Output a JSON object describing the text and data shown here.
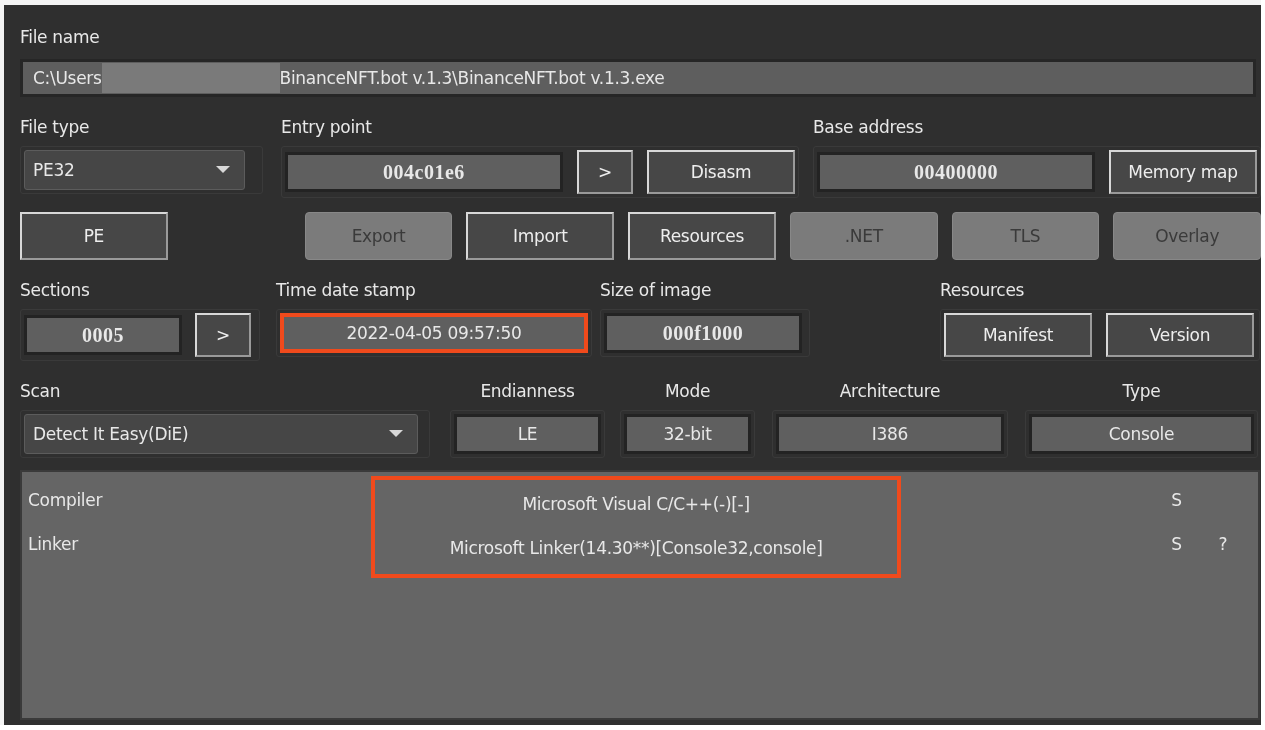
{
  "file_name": {
    "label": "File name",
    "prefix": "C:\\Users",
    "redacted": true,
    "value": "BinanceNFT.bot v.1.3\\BinanceNFT.bot v.1.3.exe"
  },
  "file_type": {
    "label": "File type",
    "value": "PE32"
  },
  "entry_point": {
    "label": "Entry point",
    "value": "004c01e6",
    "buttons": [
      {
        "label": ">",
        "disabled": false
      },
      {
        "label": "Disasm",
        "disabled": false
      }
    ]
  },
  "base_address": {
    "label": "Base address",
    "value": "00400000",
    "button": {
      "label": "Memory map",
      "disabled": false
    }
  },
  "info_buttons": [
    {
      "label": "PE",
      "disabled": false
    },
    {
      "label": "Export",
      "disabled": true
    },
    {
      "label": "Import",
      "disabled": false
    },
    {
      "label": "Resources",
      "disabled": false
    },
    {
      "label": ".NET",
      "disabled": true
    },
    {
      "label": "TLS",
      "disabled": true
    },
    {
      "label": "Overlay",
      "disabled": true
    }
  ],
  "sections": {
    "label": "Sections",
    "value": "0005",
    "button": {
      "label": ">",
      "disabled": false
    }
  },
  "time_date_stamp": {
    "label": "Time date stamp",
    "value": "2022-04-05 09:57:50",
    "highlighted": true
  },
  "size_of_image": {
    "label": "Size of image",
    "value": "000f1000"
  },
  "resources": {
    "label": "Resources",
    "buttons": [
      {
        "label": "Manifest",
        "disabled": false
      },
      {
        "label": "Version",
        "disabled": false
      }
    ]
  },
  "scan": {
    "label": "Scan",
    "value": "Detect It Easy(DiE)"
  },
  "properties": [
    {
      "label": "Endianness",
      "value": "LE"
    },
    {
      "label": "Mode",
      "value": "32-bit"
    },
    {
      "label": "Architecture",
      "value": "I386"
    },
    {
      "label": "Type",
      "value": "Console"
    }
  ],
  "results": {
    "highlighted": true,
    "rows": [
      {
        "type": "Compiler",
        "name": "Microsoft Visual C/C++(-)[-]",
        "column_3": "S"
      },
      {
        "type": "Linker",
        "name": "Microsoft Linker(14.30**)[Console32,console]",
        "column_3": "S",
        "column_4": "?"
      }
    ]
  }
}
